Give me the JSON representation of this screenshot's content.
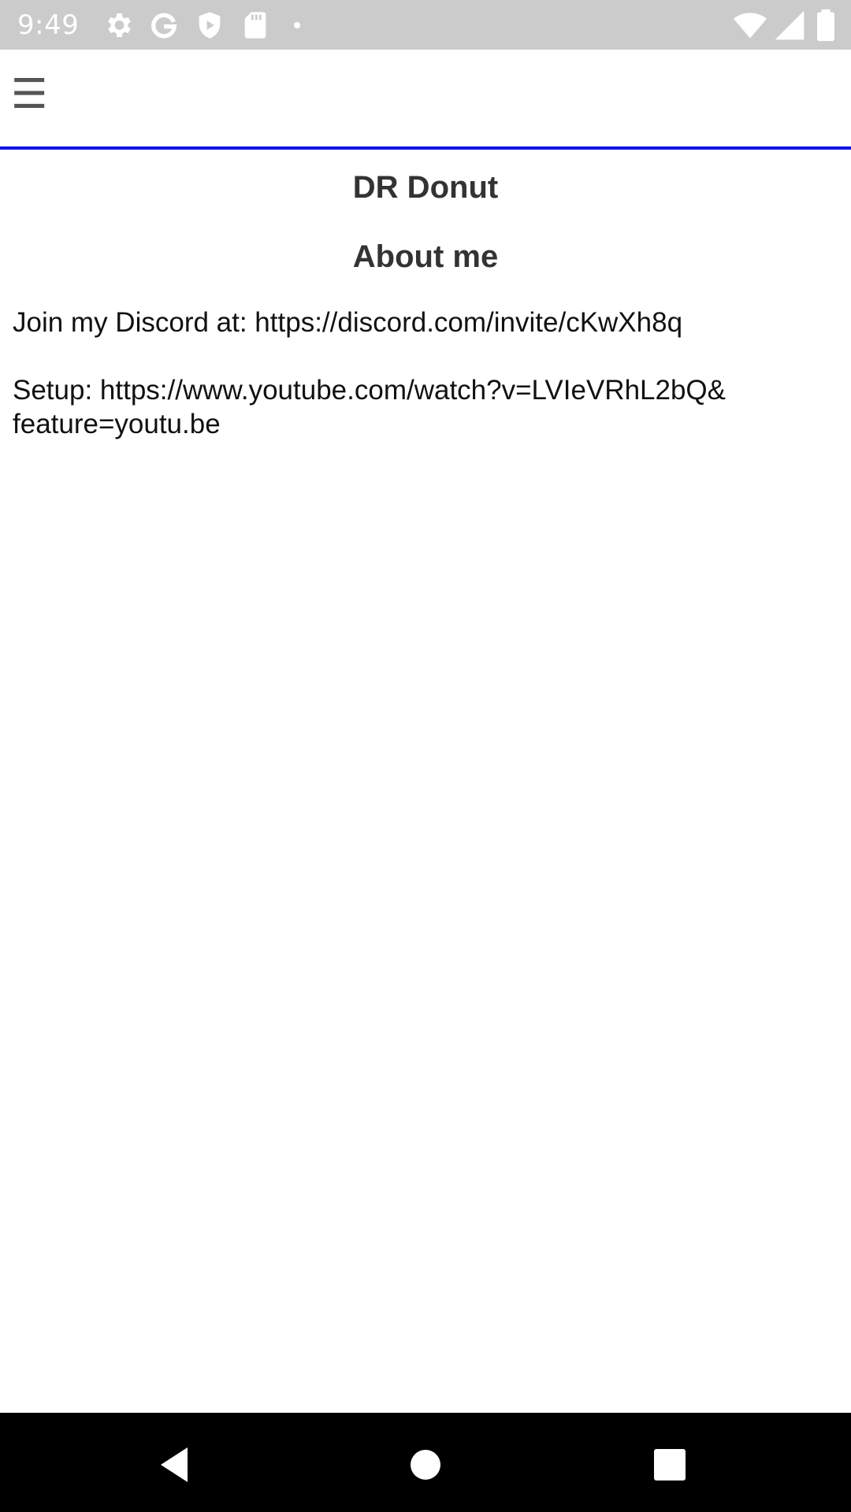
{
  "status_bar": {
    "time": "9:49",
    "left_icons": [
      "gear-icon",
      "google-icon",
      "shield-icon",
      "sd-card-icon",
      "dot-icon"
    ],
    "right_icons": [
      "wifi-icon",
      "signal-icon",
      "battery-icon"
    ]
  },
  "app_bar": {
    "menu_glyph": "☰",
    "accent_color": "#1313e0"
  },
  "page": {
    "title": "DR Donut",
    "section_heading": "About me",
    "about_lines": [
      "Join my Discord at: https://discord.com/invite/cKwXh8q",
      "Setup: https://www.youtube.com/watch?v=LVIeVRhL2bQ&",
      "feature=youtu.be"
    ]
  },
  "nav_bar": {
    "buttons": [
      "back-icon",
      "home-icon",
      "recents-icon"
    ]
  }
}
